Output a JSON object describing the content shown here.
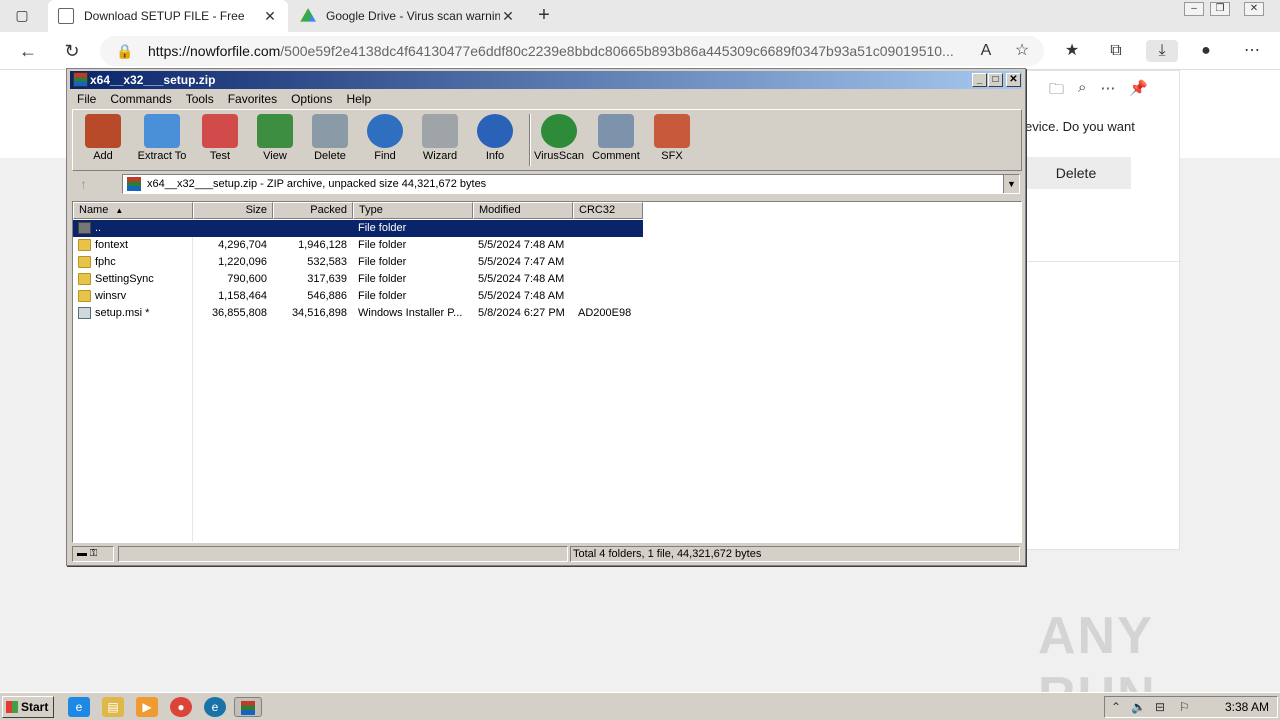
{
  "browser": {
    "tabs": [
      {
        "title": "Download SETUP FILE - Free",
        "close": "✕"
      },
      {
        "title": "Google Drive - Virus scan warning",
        "close": "✕"
      }
    ],
    "new_tab": "+",
    "url_host": "https://nowforfile.com",
    "url_path": "/500e59f2e4138dc4f64130477e6ddf80c2239e8bbdc80665b893b86a445309c6689f0347b93a51c09019510...",
    "downloads_panel": {
      "message": "evice. Do you want",
      "delete_label": "Delete"
    }
  },
  "winrar": {
    "title": "x64__x32___setup.zip",
    "menu": [
      "File",
      "Commands",
      "Tools",
      "Favorites",
      "Options",
      "Help"
    ],
    "toolbar": [
      {
        "label": "Add",
        "color": "#b84a2a"
      },
      {
        "label": "Extract To",
        "color": "#4a90d9"
      },
      {
        "label": "Test",
        "color": "#d14b4b"
      },
      {
        "label": "View",
        "color": "#3e8e41"
      },
      {
        "label": "Delete",
        "color": "#8a9aa6"
      },
      {
        "label": "Find",
        "color": "#2f6fc0"
      },
      {
        "label": "Wizard",
        "color": "#9fa4a8"
      },
      {
        "label": "Info",
        "color": "#2a62b8"
      },
      {
        "label": "VirusScan",
        "color": "#2e8b3a"
      },
      {
        "label": "Comment",
        "color": "#7d93ab"
      },
      {
        "label": "SFX",
        "color": "#c85a3c"
      }
    ],
    "path": "x64__x32___setup.zip - ZIP archive, unpacked size 44,321,672 bytes",
    "columns": [
      "Name",
      "Size",
      "Packed",
      "Type",
      "Modified",
      "CRC32"
    ],
    "sort_indicator": "▲",
    "rows": [
      {
        "name": "..",
        "size": "",
        "packed": "",
        "type": "File folder",
        "modified": "",
        "crc": "",
        "icon": "updir",
        "selected": true
      },
      {
        "name": "fontext",
        "size": "4,296,704",
        "packed": "1,946,128",
        "type": "File folder",
        "modified": "5/5/2024 7:48 AM",
        "crc": "",
        "icon": "folder"
      },
      {
        "name": "fphc",
        "size": "1,220,096",
        "packed": "532,583",
        "type": "File folder",
        "modified": "5/5/2024 7:47 AM",
        "crc": "",
        "icon": "folder"
      },
      {
        "name": "SettingSync",
        "size": "790,600",
        "packed": "317,639",
        "type": "File folder",
        "modified": "5/5/2024 7:48 AM",
        "crc": "",
        "icon": "folder"
      },
      {
        "name": "winsrv",
        "size": "1,158,464",
        "packed": "546,886",
        "type": "File folder",
        "modified": "5/5/2024 7:48 AM",
        "crc": "",
        "icon": "folder"
      },
      {
        "name": "setup.msi *",
        "size": "36,855,808",
        "packed": "34,516,898",
        "type": "Windows Installer P...",
        "modified": "5/8/2024 6:27 PM",
        "crc": "AD200E98",
        "icon": "msi"
      }
    ],
    "status": "Total 4 folders, 1 file, 44,321,672 bytes"
  },
  "taskbar": {
    "start_label": "Start",
    "clock": "3:38 AM"
  },
  "watermark": "ANY RUN"
}
